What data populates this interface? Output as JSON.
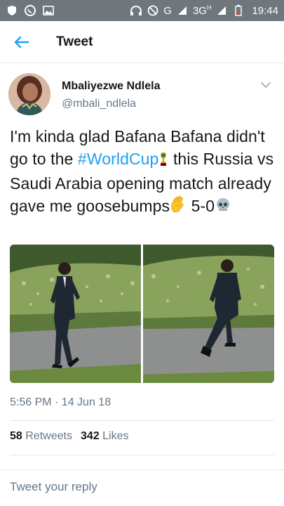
{
  "status_bar": {
    "network": "G",
    "network2": "3G",
    "network2_sup": "H",
    "time": "19:44"
  },
  "header": {
    "title": "Tweet"
  },
  "tweet": {
    "display_name": "Mbaliyezwe Ndlela",
    "handle": "@mbali_ndlela",
    "text_part1": "I'm kinda glad Bafana Bafana didn't go to the ",
    "hashtag": "#WorldCup",
    "text_part2": "  this Russia vs Saudi Arabia opening match already gave me goosebumps",
    "text_part3": " 5-0",
    "timestamp": "5:56 PM · 14 Jun 18",
    "retweets_count": "58",
    "retweets_label": "Retweets",
    "likes_count": "342",
    "likes_label": "Likes"
  },
  "reply": {
    "placeholder": "Tweet your reply"
  },
  "colors": {
    "accent": "#1da1f2",
    "status_bar": "#6f767c",
    "secondary_text": "#657786"
  }
}
